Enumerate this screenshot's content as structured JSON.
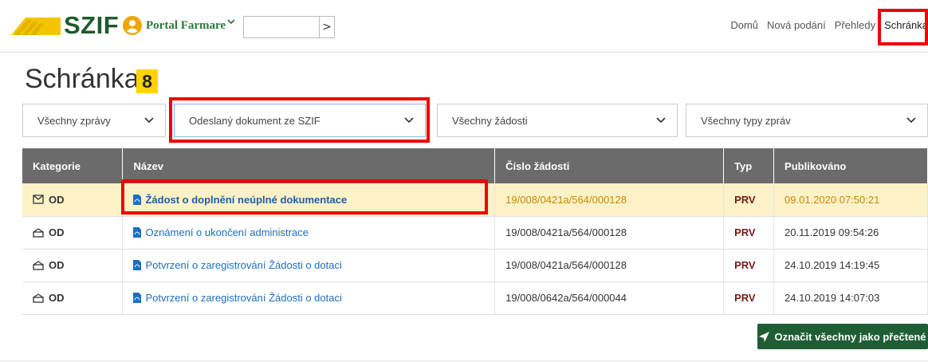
{
  "header": {
    "logo": "SZIF",
    "portal_label": "Portal Farmare",
    "quick_input_value": "",
    "go_button": ">",
    "nav": [
      "Domů",
      "Nová podání",
      "Přehledy",
      "Schránka"
    ]
  },
  "page": {
    "title": "Schránka",
    "count": "8"
  },
  "filters": {
    "messages": "Všechny zprávy",
    "document": "Odeslaný dokument ze SZIF",
    "applications": "Všechny žádosti",
    "types": "Všechny typy zpráv"
  },
  "table": {
    "headers": [
      "Kategorie",
      "Název",
      "Číslo žádosti",
      "Typ",
      "Publikováno"
    ],
    "rows": [
      {
        "category": "OD",
        "name": "Žádost o doplnění neúplné dokumentace",
        "number": "19/008/0421a/564/000128",
        "type": "PRV",
        "published": "09.01.2020 07:50:21",
        "unread": true
      },
      {
        "category": "OD",
        "name": "Oznámení o ukončení administrace",
        "number": "19/008/0421a/564/000128",
        "type": "PRV",
        "published": "20.11.2019 09:54:26",
        "unread": false
      },
      {
        "category": "OD",
        "name": "Potvrzení o zaregistrování Žádosti o dotaci",
        "number": "19/008/0421a/564/000128",
        "type": "PRV",
        "published": "24.10.2019 14:19:45",
        "unread": false
      },
      {
        "category": "OD",
        "name": "Potvrzení o zaregistrování Žádosti o dotaci",
        "number": "19/008/0642a/564/000044",
        "type": "PRV",
        "published": "24.10.2019 14:07:03",
        "unread": false
      }
    ]
  },
  "actions": {
    "mark_all_read": "Označit všechny jako přečtené"
  },
  "colors": {
    "brand_green": "#1f5a2c",
    "highlight_red": "#e00000",
    "unread_row": "#fdf1c8",
    "badge_yellow": "#ffd400"
  },
  "icons": {
    "logo": "szif-stripes-logo",
    "user": "user-circle-icon",
    "mail_unread": "envelope-icon",
    "mail_read": "envelope-open-icon",
    "document": "pdf-document-icon",
    "send": "paper-plane-icon"
  }
}
